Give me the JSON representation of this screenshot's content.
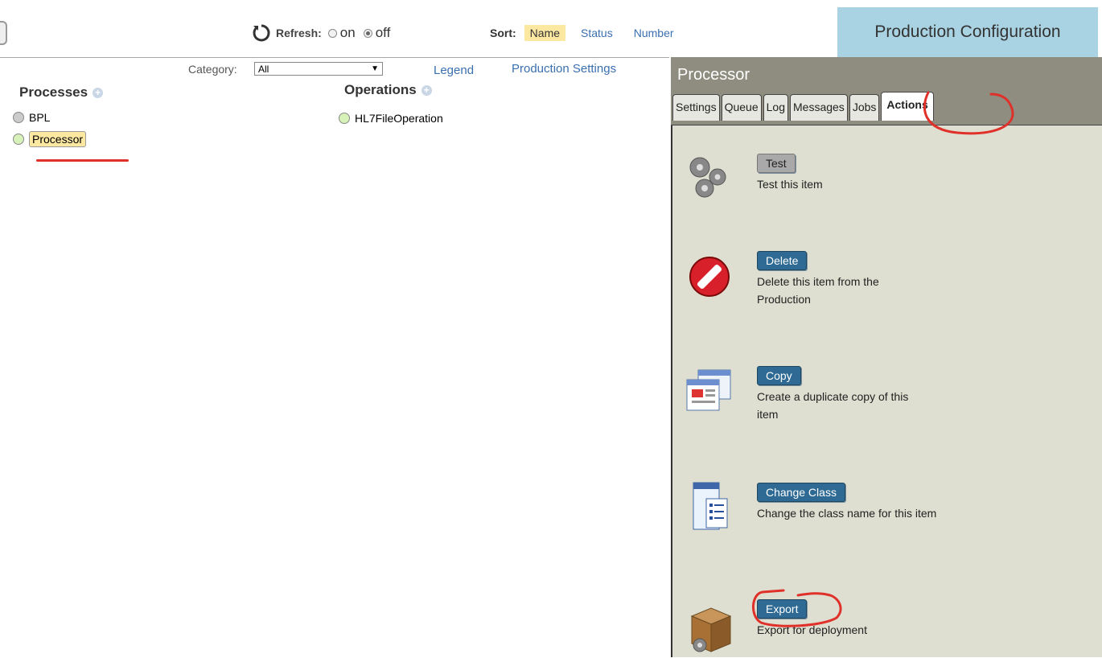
{
  "top": {
    "refresh_label": "Refresh:",
    "refresh_on": "on",
    "refresh_off": "off",
    "refresh_state": "off",
    "sort_label": "Sort:",
    "sort_options": [
      "Name",
      "Status",
      "Number"
    ],
    "sort_active": "Name",
    "title": "Production Configuration"
  },
  "filters": {
    "category_label": "Category:",
    "category_value": "All",
    "legend_link": "Legend",
    "settings_link": "Production Settings"
  },
  "processes": {
    "header": "Processes",
    "items": [
      {
        "label": "BPL",
        "status_color": "#cccccc"
      },
      {
        "label": "Processor",
        "status_color": "#d7f2b8",
        "selected": true
      }
    ]
  },
  "operations": {
    "header": "Operations",
    "items": [
      {
        "label": "HL7FileOperation",
        "status_color": "#d7f2b8"
      }
    ]
  },
  "panel": {
    "title": "Processor",
    "tabs": [
      "Settings",
      "Queue",
      "Log",
      "Messages",
      "Jobs",
      "Actions"
    ],
    "active_tab": "Actions",
    "actions": [
      {
        "button": "Test",
        "desc": "Test this item",
        "icon": "gears-icon"
      },
      {
        "button": "Delete",
        "desc": "Delete this item from the Production",
        "icon": "no-entry-icon"
      },
      {
        "button": "Copy",
        "desc": "Create a duplicate copy of this item",
        "icon": "copy-windows-icon"
      },
      {
        "button": "Change Class",
        "desc": "Change the class name for this item",
        "icon": "class-document-icon"
      },
      {
        "button": "Export",
        "desc": "Export for deployment",
        "icon": "package-box-icon"
      }
    ]
  },
  "colors": {
    "accent_link": "#3a6fb0",
    "highlight": "#fde8a2",
    "title_bg": "#a9d3e2",
    "panel_bg": "#dedfd1",
    "panel_header": "#8e8d80",
    "button_blue": "#2e6a93",
    "annotation_red": "#e0302a"
  }
}
